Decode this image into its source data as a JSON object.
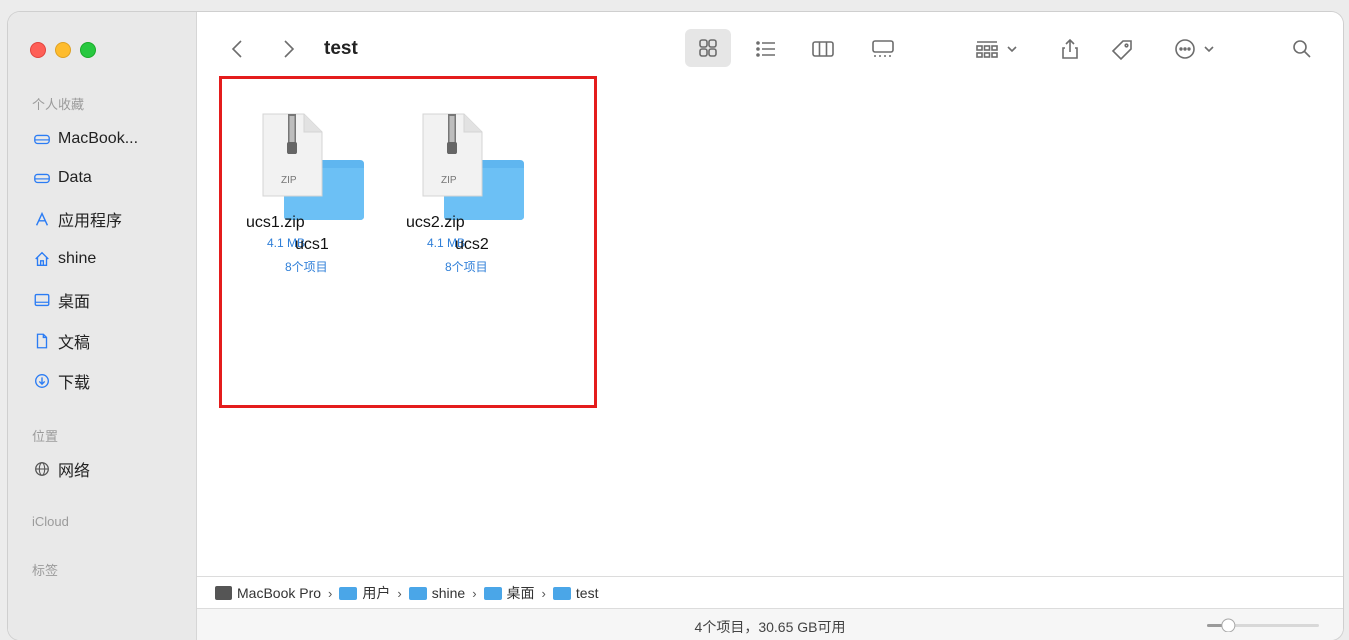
{
  "window": {
    "title": "test"
  },
  "sidebar": {
    "sections": [
      {
        "header": "个人收藏",
        "items": [
          {
            "label": "MacBook...",
            "icon": "drive-icon"
          },
          {
            "label": "Data",
            "icon": "drive-icon"
          },
          {
            "label": "应用程序",
            "icon": "apps-icon"
          },
          {
            "label": "shine",
            "icon": "home-icon"
          },
          {
            "label": "桌面",
            "icon": "desktop-icon"
          },
          {
            "label": "文稿",
            "icon": "document-icon"
          },
          {
            "label": "下载",
            "icon": "download-icon"
          }
        ]
      },
      {
        "header": "位置",
        "items": [
          {
            "label": "网络",
            "icon": "network-icon"
          }
        ]
      },
      {
        "header": "iCloud",
        "items": []
      },
      {
        "header": "标签",
        "items": []
      }
    ]
  },
  "files": [
    {
      "name": "ucs1.zip",
      "size": "4.1 MB",
      "folder_name": "ucs1",
      "folder_count": "8个项目",
      "zip_label": "ZIP"
    },
    {
      "name": "ucs2.zip",
      "size": "4.1 MB",
      "folder_name": "ucs2",
      "folder_count": "8个项目",
      "zip_label": "ZIP"
    }
  ],
  "pathbar": {
    "items": [
      "MacBook Pro",
      "用户",
      "shine",
      "桌面",
      "test"
    ],
    "separator": "›"
  },
  "status": {
    "text": "4个项目，30.65 GB可用",
    "zoom_level": 0.15
  },
  "colors": {
    "folder_blue": "#5fb6f0",
    "highlight_red": "#e41c1c",
    "accent": "#2b7cf4"
  }
}
